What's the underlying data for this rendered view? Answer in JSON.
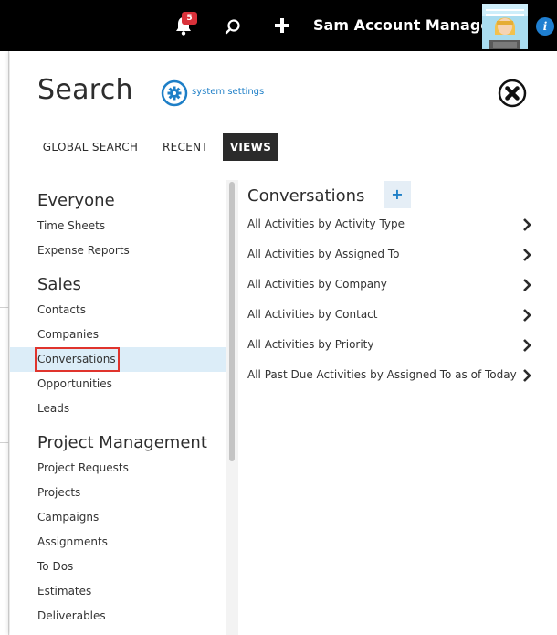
{
  "topbar": {
    "notification_count": "5",
    "user_name": "Sam Account Manager",
    "icons": [
      "bell-icon",
      "search-icon",
      "plus-icon",
      "avatar",
      "info-icon"
    ],
    "info_glyph": "i"
  },
  "panel": {
    "title": "Search",
    "settings_link": "system settings",
    "close_icon": "close-icon",
    "tabs": [
      {
        "label": "GLOBAL SEARCH",
        "active": false
      },
      {
        "label": "RECENT",
        "active": false
      },
      {
        "label": "VIEWS",
        "active": true
      }
    ]
  },
  "categories": {
    "groups": [
      {
        "heading": "Everyone",
        "items": [
          "Time Sheets",
          "Expense Reports"
        ]
      },
      {
        "heading": "Sales",
        "items": [
          "Contacts",
          "Companies",
          "Conversations",
          "Opportunities",
          "Leads"
        ]
      },
      {
        "heading": "Project Management",
        "items": [
          "Project Requests",
          "Projects",
          "Campaigns",
          "Assignments",
          "To Dos",
          "Estimates",
          "Deliverables"
        ]
      }
    ],
    "selected": "Conversations"
  },
  "views": {
    "title": "Conversations",
    "add_label": "+",
    "items": [
      "All Activities by Activity Type",
      "All Activities by Assigned To",
      "All Activities by Company",
      "All Activities by Contact",
      "All Activities by Priority",
      "All Past Due Activities by Assigned To as of Today"
    ]
  },
  "colors": {
    "topbar": "#000000",
    "accent": "#1e7fc7",
    "selected_row": "#dcedf8",
    "highlight_border": "#e0342d",
    "badge": "#d9313a"
  }
}
